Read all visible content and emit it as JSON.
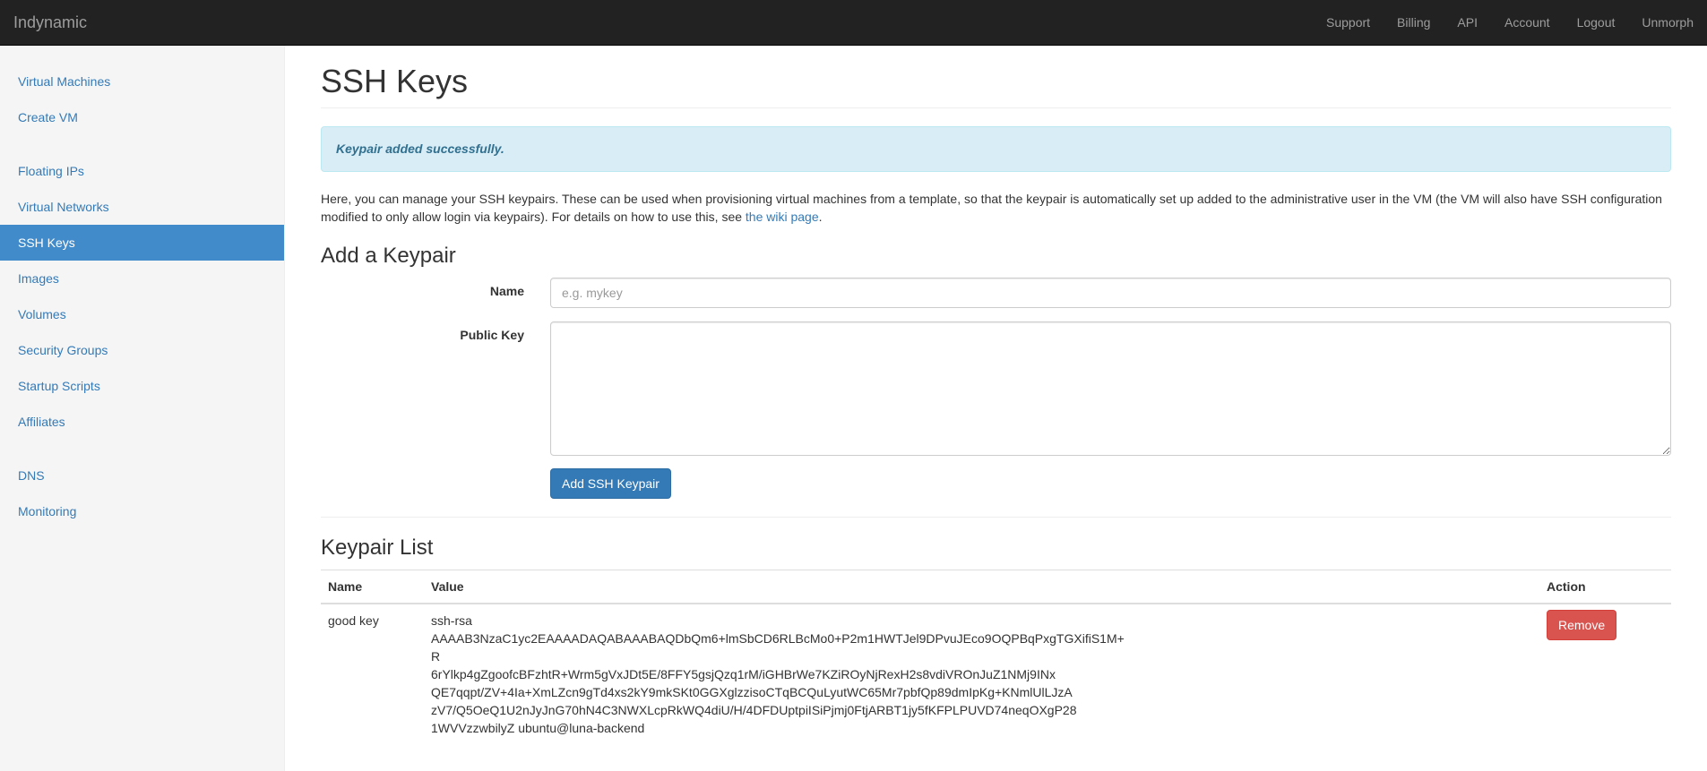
{
  "navbar": {
    "brand": "Indynamic",
    "links": [
      "Support",
      "Billing",
      "API",
      "Account",
      "Logout",
      "Unmorph"
    ]
  },
  "sidebar": {
    "groups": [
      [
        "Virtual Machines",
        "Create VM"
      ],
      [
        "Floating IPs",
        "Virtual Networks",
        "SSH Keys",
        "Images",
        "Volumes",
        "Security Groups",
        "Startup Scripts",
        "Affiliates"
      ],
      [
        "DNS",
        "Monitoring"
      ]
    ],
    "active": "SSH Keys"
  },
  "main": {
    "title": "SSH Keys",
    "alert": "Keypair added successfully.",
    "intro": "Here, you can manage your SSH keypairs. These can be used when provisioning virtual machines from a template, so that the keypair is automatically set up added to the administrative user in the VM (the VM will also have SSH configuration modified to only allow login via keypairs). For details on how to use this, see ",
    "intro_link": "the wiki page",
    "intro_end": "."
  },
  "form": {
    "heading": "Add a Keypair",
    "name_label": "Name",
    "name_placeholder": "e.g. mykey",
    "name_value": "",
    "public_key_label": "Public Key",
    "public_key_value": "",
    "submit_label": "Add SSH Keypair"
  },
  "keypairs": {
    "heading": "Keypair List",
    "columns": [
      "Name",
      "Value",
      "Action"
    ],
    "rows": [
      {
        "name": "good key",
        "value_lines": [
          "ssh-rsa",
          "AAAAB3NzaC1yc2EAAAADAQABAAABAQDbQm6+lmSbCD6RLBcMo0+P2m1HWTJel9DPvuJEco9OQPBqPxgTGXifiS1M+R",
          "6rYlkp4gZgoofcBFzhtR+Wrm5gVxJDt5E/8FFY5gsjQzq1rM/iGHBrWe7KZiROyNjRexH2s8vdiVROnJuZ1NMj9INx",
          "QE7qqpt/ZV+4Ia+XmLZcn9gTd4xs2kY9mkSKt0GGXglzzisoCTqBCQuLyutWC65Mr7pbfQp89dmIpKg+KNmlUlLJzA",
          "zV7/Q5OeQ1U2nJyJnG70hN4C3NWXLcpRkWQ4diU/H/4DFDUptpiISiPjmj0FtjARBT1jy5fKFPLPUVD74neqOXgP28",
          "1WVVzzwbilyZ ubuntu@luna-backend"
        ],
        "action": "Remove"
      }
    ]
  }
}
